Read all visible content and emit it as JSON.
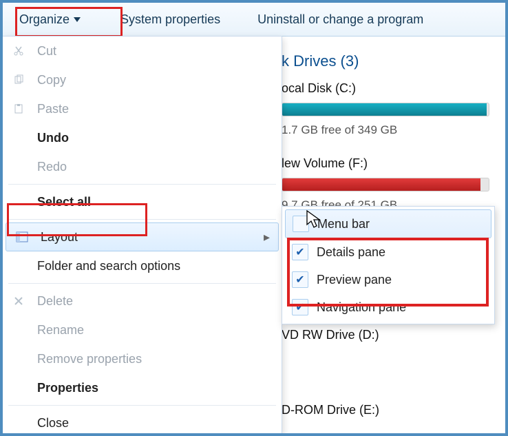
{
  "toolbar": {
    "organize": "Organize",
    "sysprops": "System properties",
    "uninstall": "Uninstall or change a program"
  },
  "drives": {
    "section": "k Drives (3)",
    "c": {
      "name": "ocal Disk (C:)",
      "free": "1.7 GB free of 349 GB",
      "fill_pct": 99,
      "fill_color": "#17b0c4"
    },
    "f": {
      "name": "lew Volume (F:)",
      "free": "9.7 GB free of 251 GB",
      "fill_pct": 96,
      "fill_color": "#e23b3b"
    },
    "d": {
      "name": "VD RW Drive (D:)"
    },
    "e": {
      "name": "D-ROM Drive (E:)"
    }
  },
  "menu": {
    "cut": "Cut",
    "copy": "Copy",
    "paste": "Paste",
    "undo": "Undo",
    "redo": "Redo",
    "selectall": "Select all",
    "layout": "Layout",
    "folderopts": "Folder and search options",
    "delete": "Delete",
    "rename": "Rename",
    "removeprops": "Remove properties",
    "properties": "Properties",
    "close": "Close"
  },
  "submenu": {
    "menubar": {
      "label": "Menu bar",
      "checked": false
    },
    "details": {
      "label": "Details pane",
      "checked": true
    },
    "preview": {
      "label": "Preview pane",
      "checked": true
    },
    "nav": {
      "label": "Navigation pane",
      "checked": true
    }
  }
}
